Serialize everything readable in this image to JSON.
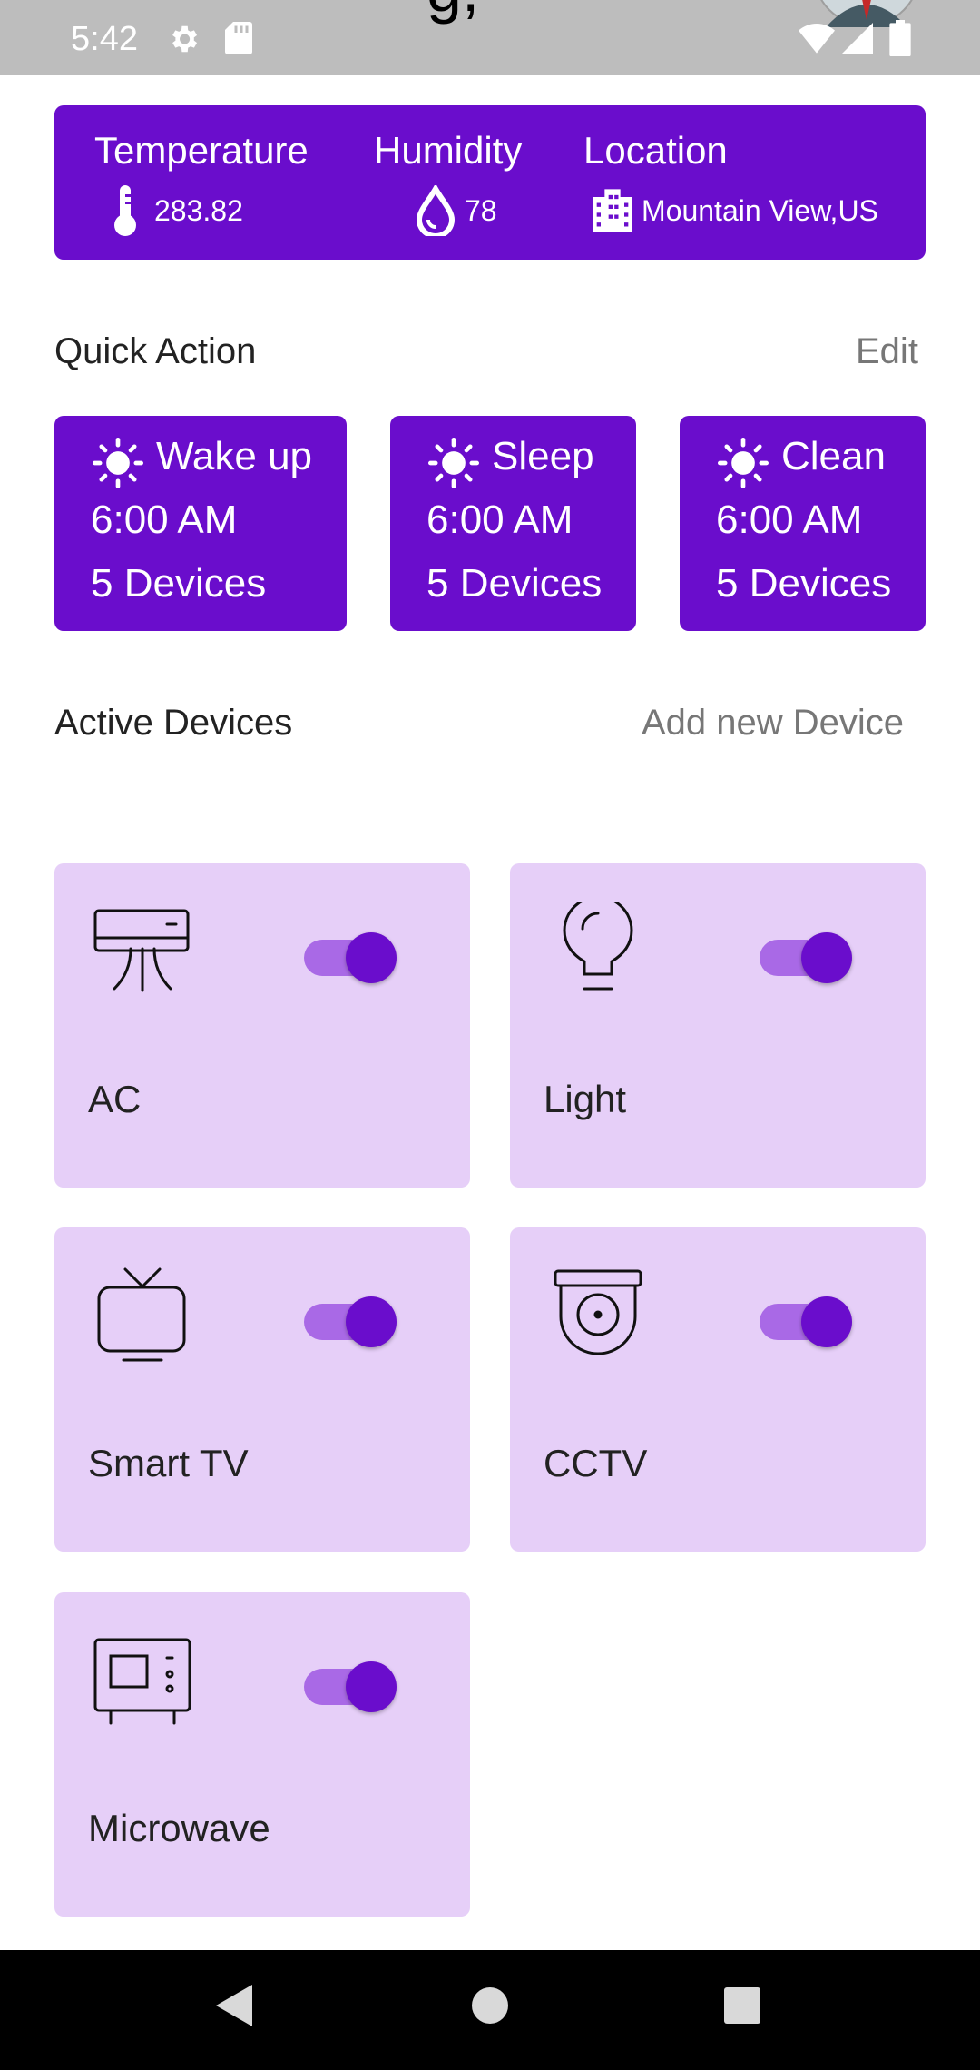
{
  "status_bar": {
    "time": "5:42",
    "icons": [
      "settings-icon",
      "sd-card-icon",
      "wifi-icon",
      "signal-icon",
      "battery-icon"
    ]
  },
  "header": {
    "title_partial": "g,"
  },
  "weather": {
    "temperature": {
      "label": "Temperature",
      "value": "283.82",
      "icon": "thermometer-icon"
    },
    "humidity": {
      "label": "Humidity",
      "value": "78",
      "icon": "water-drop-icon"
    },
    "location": {
      "label": "Location",
      "value": "Mountain View,US",
      "icon": "city-icon"
    }
  },
  "quick_action": {
    "title": "Quick Action",
    "edit_label": "Edit",
    "items": [
      {
        "name": "Wake up",
        "time": "6:00 AM",
        "devices": "5 Devices",
        "icon": "sun-icon"
      },
      {
        "name": "Sleep",
        "time": "6:00 AM",
        "devices": "5 Devices",
        "icon": "sun-icon"
      },
      {
        "name": "Clean",
        "time": "6:00 AM",
        "devices": "5 Devices",
        "icon": "sun-icon"
      }
    ]
  },
  "active_devices": {
    "title": "Active Devices",
    "add_label": "Add new Device",
    "items": [
      {
        "name": "AC",
        "icon": "air-conditioner-icon",
        "on": true
      },
      {
        "name": "Light",
        "icon": "light-bulb-icon",
        "on": true
      },
      {
        "name": "Smart TV",
        "icon": "tv-icon",
        "on": true
      },
      {
        "name": "CCTV",
        "icon": "cctv-camera-icon",
        "on": true
      },
      {
        "name": "Microwave",
        "icon": "microwave-icon",
        "on": true
      }
    ]
  },
  "colors": {
    "primary": "#6a0dcc",
    "card_bg": "#e6cff8",
    "toggle_track": "#a969e6",
    "status_bar": "#bdbdbd"
  },
  "nav_bar": {
    "buttons": [
      "back-icon",
      "home-icon",
      "recents-icon"
    ]
  }
}
